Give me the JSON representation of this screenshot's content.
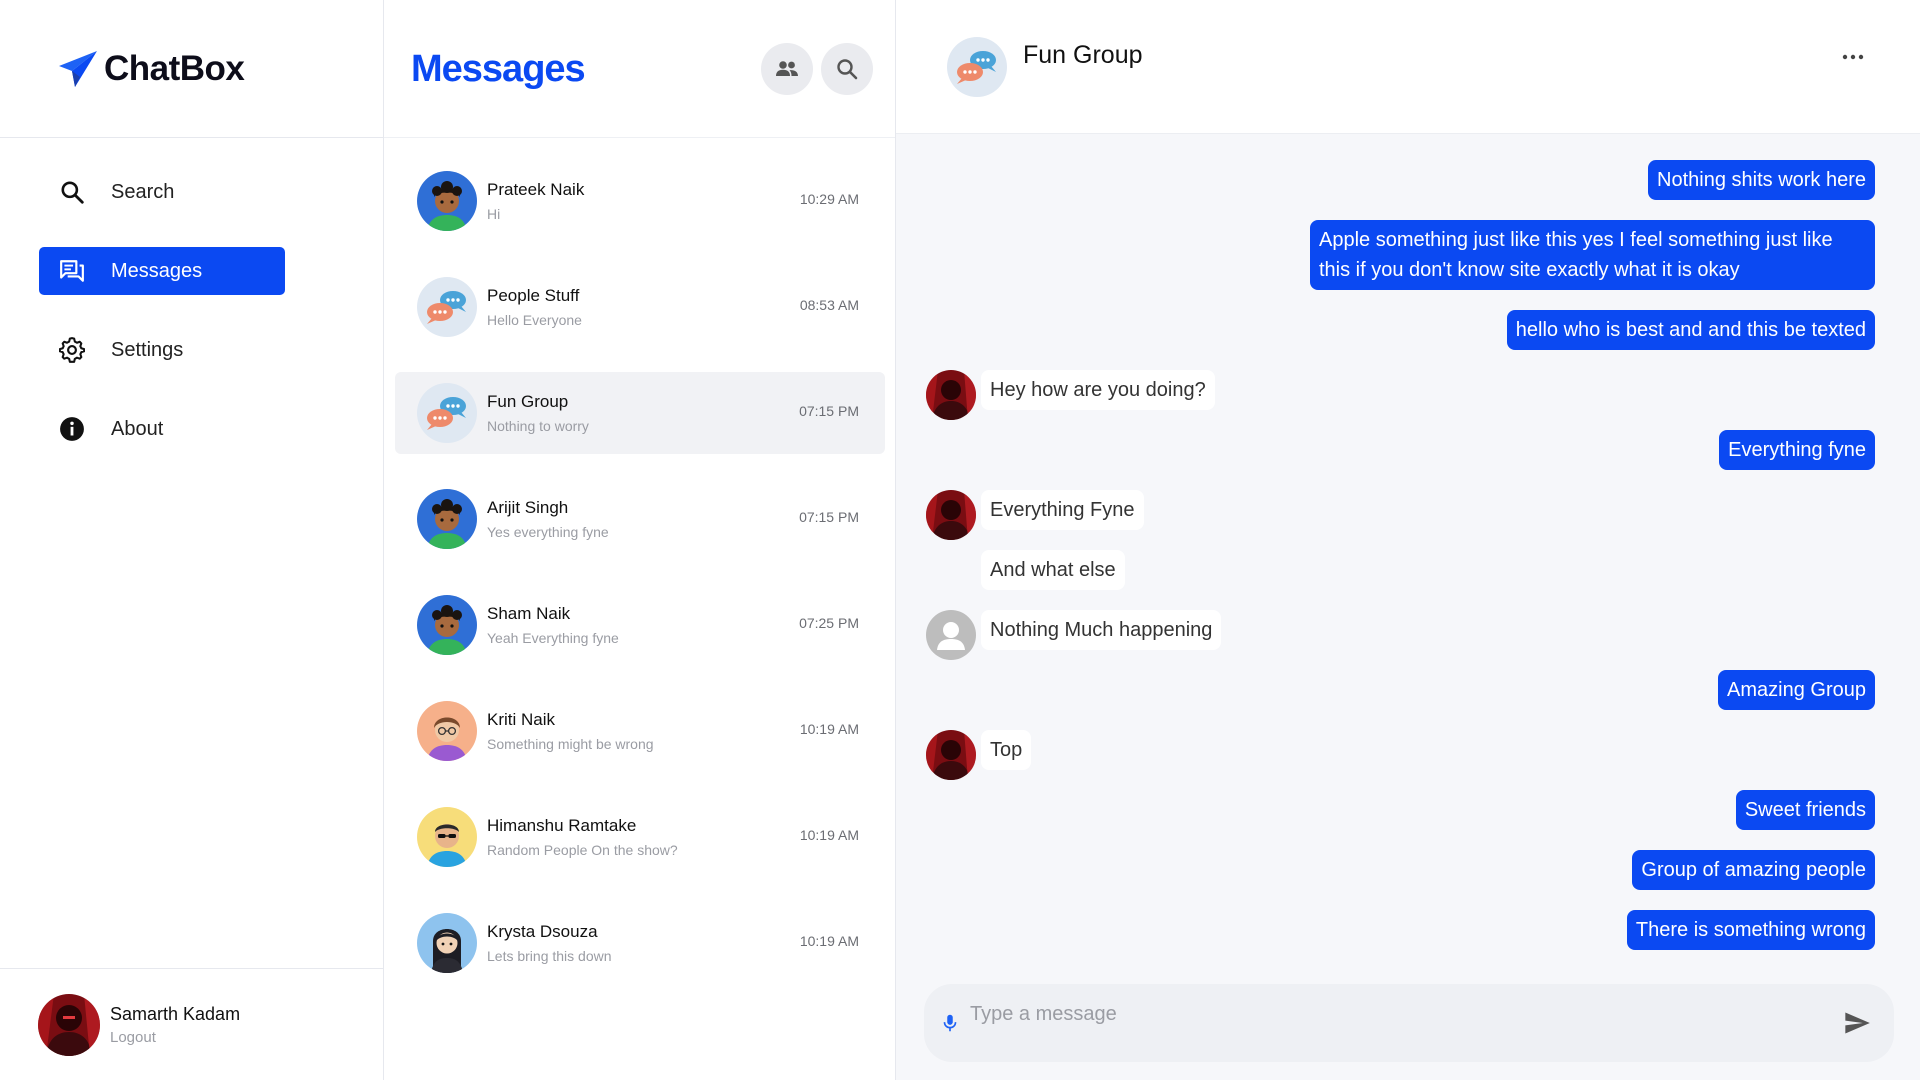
{
  "app": {
    "name": "ChatBox"
  },
  "sidebar": {
    "items": [
      {
        "label": "Search",
        "icon": "search-icon",
        "active": false
      },
      {
        "label": "Messages",
        "icon": "messages-icon",
        "active": true
      },
      {
        "label": "Settings",
        "icon": "gear-icon",
        "active": false
      },
      {
        "label": "About",
        "icon": "info-icon",
        "active": false
      }
    ],
    "user": {
      "name": "Samarth Kadam",
      "action": "Logout"
    }
  },
  "conversations": {
    "title": "Messages",
    "items": [
      {
        "name": "Prateek Naik",
        "last": "Hi",
        "time": "10:29 AM",
        "avatar": "boy-curly-avatar",
        "selected": false
      },
      {
        "name": "People Stuff",
        "last": "Hello Everyone",
        "time": "08:53 AM",
        "avatar": "chat-bubbles-avatar",
        "selected": false
      },
      {
        "name": "Fun Group",
        "last": "Nothing to worry",
        "time": "07:15 PM",
        "avatar": "chat-bubbles-avatar",
        "selected": true
      },
      {
        "name": "Arijit Singh",
        "last": "Yes everything fyne",
        "time": "07:15 PM",
        "avatar": "boy-curly-avatar",
        "selected": false
      },
      {
        "name": "Sham Naik",
        "last": "Yeah Everything fyne",
        "time": "07:25 PM",
        "avatar": "boy-curly-avatar",
        "selected": false
      },
      {
        "name": "Kriti Naik",
        "last": "Something might be wrong",
        "time": "10:19 AM",
        "avatar": "girl-glasses-avatar",
        "selected": false
      },
      {
        "name": "Himanshu Ramtake",
        "last": "Random People On the show?",
        "time": "10:19 AM",
        "avatar": "man-sunglasses-avatar",
        "selected": false
      },
      {
        "name": "Krysta Dsouza",
        "last": "Lets bring this down",
        "time": "10:19 AM",
        "avatar": "woman-dark-hair-avatar",
        "selected": false
      }
    ]
  },
  "chat": {
    "title": "Fun Group",
    "messages": [
      {
        "dir": "out",
        "text": "Nothing shits work here"
      },
      {
        "dir": "out",
        "text": "Apple something just like this yes I feel something just like this if you don't know site exactly what it is okay"
      },
      {
        "dir": "out",
        "text": "hello who is best and and this be texted"
      },
      {
        "dir": "in",
        "text": "Hey how are you doing?",
        "avatar": "red-portrait-avatar"
      },
      {
        "dir": "out",
        "text": "Everything fyne"
      },
      {
        "dir": "in",
        "text": "Everything Fyne",
        "avatar": "red-portrait-avatar"
      },
      {
        "dir": "in",
        "text": "And what else",
        "avatar": ""
      },
      {
        "dir": "in",
        "text": "Nothing Much happening",
        "avatar": "default-user-avatar"
      },
      {
        "dir": "out",
        "text": "Amazing Group"
      },
      {
        "dir": "in",
        "text": "Top",
        "avatar": "red-portrait-avatar"
      },
      {
        "dir": "out",
        "text": "Sweet friends"
      },
      {
        "dir": "out",
        "text": "Group of amazing people"
      },
      {
        "dir": "out",
        "text": "There is something wrong"
      }
    ],
    "input": {
      "placeholder": "Type a message",
      "value": ""
    }
  },
  "colors": {
    "accent": "#0b49f2",
    "chat_bg": "#f6f7fa",
    "muted": "#9a9ca3"
  }
}
